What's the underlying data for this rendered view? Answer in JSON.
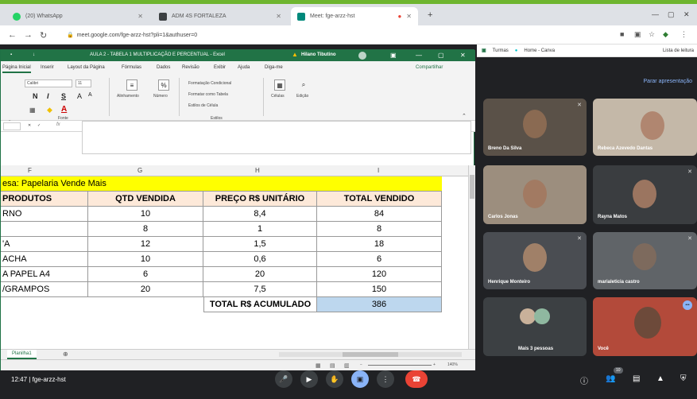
{
  "browser": {
    "tabs": [
      {
        "title": "(20) WhatsApp",
        "color": "#25d366"
      },
      {
        "title": "ADM 4S FORTALEZA",
        "color": "#3c4043"
      },
      {
        "title": "Meet: fge-arzz-hst",
        "color": "#00897b"
      }
    ],
    "new_tab": "+",
    "url": "meet.google.com/fge-arzz-hst?pli=1&authuser=0",
    "bookmarks": [
      "Turmas",
      "Home - Canva",
      "Lista de leitura"
    ]
  },
  "excel": {
    "title": "AULA 2 - TABELA 1 MULTIPLICAÇÃO E PERCENTUAL  -  Excel",
    "user": "Hilano Tibutino",
    "menu": [
      "Página Inicial",
      "Inserir",
      "Layout da Página",
      "Fórmulas",
      "Dados",
      "Revisão",
      "Exibir",
      "Ajuda",
      "Diga-me",
      "Compartilhar"
    ],
    "ribbon": {
      "font": "Calibri",
      "size": "11",
      "bold": "N",
      "italic": "I",
      "underline": "S",
      "grow": "A",
      "shrink": "A",
      "align_label": "Alinhamento",
      "number_label": "Número",
      "percent": "%",
      "cond_fmt": "Formatação Condicional",
      "table_fmt": "Formatar como Tabela",
      "cell_styles": "Estilos de Célula",
      "cells_label": "Células",
      "edit_label": "Edição",
      "font_group": "Fonte",
      "styles_group": "Estilos",
      "clip_group": "rea. Tr",
      "fx": "fx"
    },
    "columns": [
      "F",
      "G",
      "H",
      "I"
    ],
    "company": "esa: Papelaria Vende Mais",
    "headers": [
      "PRODUTOS",
      "QTD VENDIDA",
      "PREÇO R$ UNITÁRIO",
      "TOTAL VENDIDO"
    ],
    "rows": [
      [
        "RNO",
        "10",
        "8,4",
        "84"
      ],
      [
        "",
        "8",
        "1",
        "8"
      ],
      [
        "'A",
        "12",
        "1,5",
        "18"
      ],
      [
        "ACHA",
        "10",
        "0,6",
        "6"
      ],
      [
        "A PAPEL A4",
        "6",
        "20",
        "120"
      ],
      [
        "/GRAMPOS",
        "20",
        "7,5",
        "150"
      ]
    ],
    "total_label": "TOTAL R$ ACUMULADO",
    "total_value": "386",
    "sheet": "Planilha1",
    "zoom": "140%"
  },
  "meet": {
    "present": "Parar apresentação",
    "participants": [
      "Breno Da Silva",
      "Rebeca Azevedo Dantas",
      "Carlos Jonas",
      "Rayna Matos",
      "Henrique Monteiro",
      "marialeticia castro",
      "Mais 3 pessoas",
      "Você"
    ],
    "time": "12:47",
    "code": "fge-arzz-hst",
    "badge": "10"
  }
}
